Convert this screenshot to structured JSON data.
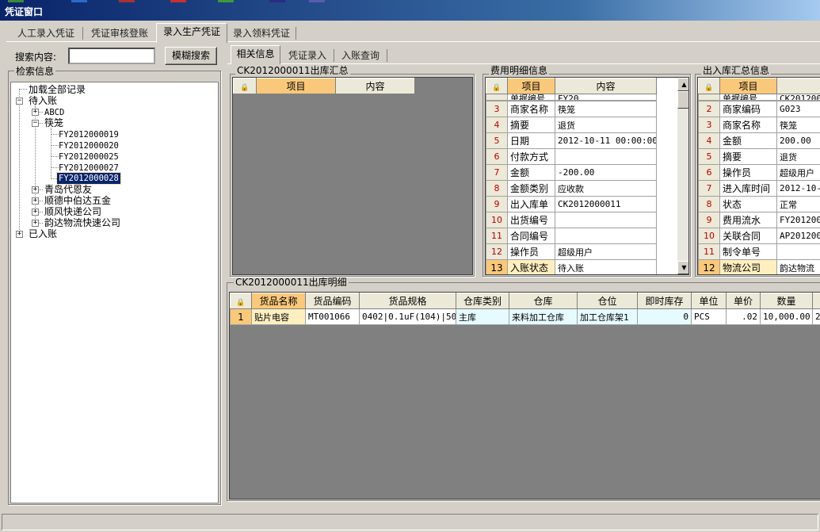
{
  "window": {
    "title": "凭证窗口"
  },
  "main_tabs": [
    {
      "label": "人工录入凭证"
    },
    {
      "label": "凭证审核登账"
    },
    {
      "label": "录入生产凭证"
    },
    {
      "label": "录入领料凭证"
    }
  ],
  "search": {
    "label": "搜索内容:",
    "value": "",
    "button_label": "模糊搜索"
  },
  "retrieval": {
    "title": "检索信息",
    "load_all": "加载全部记录",
    "pending": "待入账",
    "posted": "已入账",
    "nodes": {
      "abcd": "ABCD",
      "kuaizi": "筷笼",
      "qingdao": "青岛代恩友",
      "shunde": "顺德中伯达五金",
      "shunfeng": "顺风快递公司",
      "yunda": "韵达物流快速公司"
    },
    "vouchers": [
      "FY2012000019",
      "FY2012000020",
      "FY2012000025",
      "FY2012000027",
      "FY2012000028"
    ]
  },
  "sub_tabs": [
    {
      "label": "相关信息"
    },
    {
      "label": "凭证录入"
    },
    {
      "label": "入账查询"
    }
  ],
  "outbound_summary": {
    "title": "CK2012000011出库汇总",
    "col_item": "项目",
    "col_content": "内容"
  },
  "expense_detail": {
    "title": "费用明细信息",
    "col_item": "项目",
    "col_content": "内容",
    "partial_row": {
      "item": "单据编号",
      "content": "FY20"
    },
    "rows": [
      {
        "n": "3",
        "item": "商家名称",
        "content": "筷笼"
      },
      {
        "n": "4",
        "item": "摘要",
        "content": "退货"
      },
      {
        "n": "5",
        "item": "日期",
        "content": "2012-10-11 00:00:00"
      },
      {
        "n": "6",
        "item": "付款方式",
        "content": ""
      },
      {
        "n": "7",
        "item": "金额",
        "content": "-200.00"
      },
      {
        "n": "8",
        "item": "金额类别",
        "content": "应收款"
      },
      {
        "n": "9",
        "item": "出入库单",
        "content": "CK2012000011"
      },
      {
        "n": "10",
        "item": "出货编号",
        "content": ""
      },
      {
        "n": "11",
        "item": "合同编号",
        "content": ""
      },
      {
        "n": "12",
        "item": "操作员",
        "content": "超级用户"
      },
      {
        "n": "13",
        "item": "入账状态",
        "content": "待入账"
      }
    ]
  },
  "inout_summary": {
    "title": "出入库汇总信息",
    "col_item": "项目",
    "col_content": "内",
    "partial_row": {
      "item": "单据编号",
      "content": "CK201200"
    },
    "rows": [
      {
        "n": "2",
        "item": "商家编码",
        "content": "G023"
      },
      {
        "n": "3",
        "item": "商家名称",
        "content": "筷笼"
      },
      {
        "n": "4",
        "item": "金额",
        "content": "200.00"
      },
      {
        "n": "5",
        "item": "摘要",
        "content": "退货"
      },
      {
        "n": "6",
        "item": "操作员",
        "content": "超级用户"
      },
      {
        "n": "7",
        "item": "进入库时间",
        "content": "2012-10-"
      },
      {
        "n": "8",
        "item": "状态",
        "content": "正常"
      },
      {
        "n": "9",
        "item": "费用流水",
        "content": "FY201200"
      },
      {
        "n": "10",
        "item": "关联合同",
        "content": "AP201200"
      },
      {
        "n": "11",
        "item": "制令单号",
        "content": ""
      },
      {
        "n": "12",
        "item": "物流公司",
        "content": "韵达物流"
      }
    ]
  },
  "outbound_detail": {
    "title": "CK2012000011出库明细",
    "columns": [
      "货品名称",
      "货品编码",
      "货品规格",
      "仓库类别",
      "仓库",
      "仓位",
      "即时库存",
      "单位",
      "单价",
      "数量"
    ],
    "rows": [
      {
        "n": "1",
        "cells": [
          "贴片电容",
          "MT001066",
          "0402|0.1uF(104)|50",
          "主库",
          "来料加工仓库",
          "加工仓库架1",
          "0",
          "PCS",
          ".02",
          "10,000.00"
        ],
        "extra": "2"
      }
    ]
  }
}
